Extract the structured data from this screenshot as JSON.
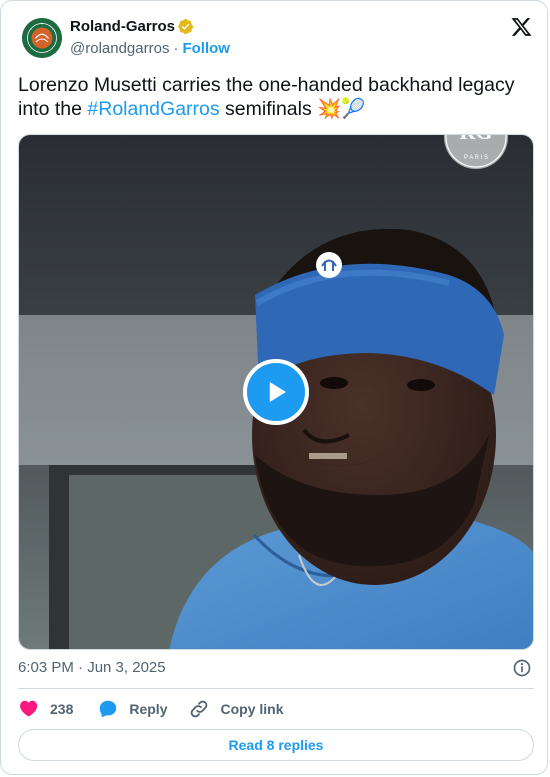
{
  "author": {
    "name": "Roland-Garros",
    "handle": "@rolandgarros",
    "separator": "·",
    "follow_label": "Follow",
    "verified": true
  },
  "tweet": {
    "text_before": "Lorenzo Musetti carries the one-handed backhand legacy into the ",
    "hashtag": "#RolandGarros",
    "text_after": " semifinals ",
    "emoji": "💥🎾"
  },
  "media": {
    "type": "video",
    "watermark": "RG PARIS",
    "play_icon": "play-icon"
  },
  "meta": {
    "timestamp": "6:03 PM · Jun 3, 2025"
  },
  "actions": {
    "like_count": "238",
    "reply_label": "Reply",
    "copy_label": "Copy link"
  },
  "footer": {
    "read_replies_label": "Read 8 replies"
  },
  "colors": {
    "accent": "#1d9bf0",
    "like": "#f91880",
    "text": "#0f1419",
    "muted": "#536471",
    "border": "#cfd9de",
    "brand_green": "#1c6b41",
    "brand_orange": "#d4632a"
  }
}
